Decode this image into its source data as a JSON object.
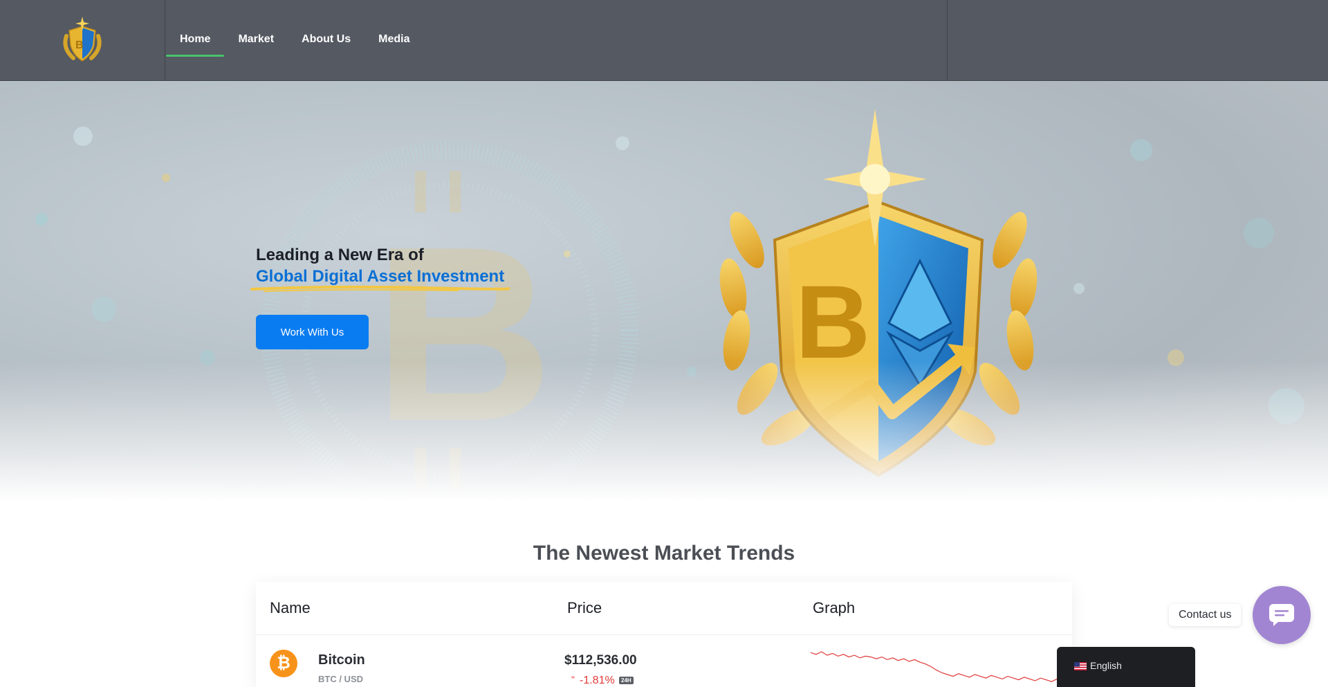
{
  "header": {
    "logo_alt": "Crypto shield logo",
    "nav": [
      {
        "label": "Home",
        "active": true
      },
      {
        "label": "Market",
        "active": false
      },
      {
        "label": "About Us",
        "active": false
      },
      {
        "label": "Media",
        "active": false
      }
    ]
  },
  "hero": {
    "line1": "Leading a New Era of",
    "line2": "Global Digital Asset Investment",
    "cta_label": "Work With Us",
    "accent_color": "#0a6fd4",
    "button_color": "#0a7cf2"
  },
  "market": {
    "title": "The Newest Market Trends",
    "columns": [
      "Name",
      "Price",
      "Graph"
    ],
    "rows": [
      {
        "icon": "bitcoin-icon",
        "name": "Bitcoin",
        "pair": "BTC / USD",
        "price": "$112,536.00",
        "change_arrow": "\"",
        "change": "-1.81%",
        "period": "24H",
        "change_color": "#e03838",
        "sparkline": [
          60,
          58,
          61,
          57,
          59,
          56,
          58,
          55,
          57,
          54,
          56,
          55,
          53,
          55,
          52,
          54,
          51,
          53,
          50,
          52,
          49,
          47,
          44,
          40,
          37,
          35,
          33,
          36,
          34,
          32,
          35,
          33,
          31,
          34,
          32,
          30,
          33,
          31,
          29,
          32,
          30,
          28,
          31,
          29,
          27,
          30,
          28,
          26,
          24
        ]
      }
    ]
  },
  "language": {
    "label": "English"
  },
  "contact": {
    "label": "Contact us"
  }
}
